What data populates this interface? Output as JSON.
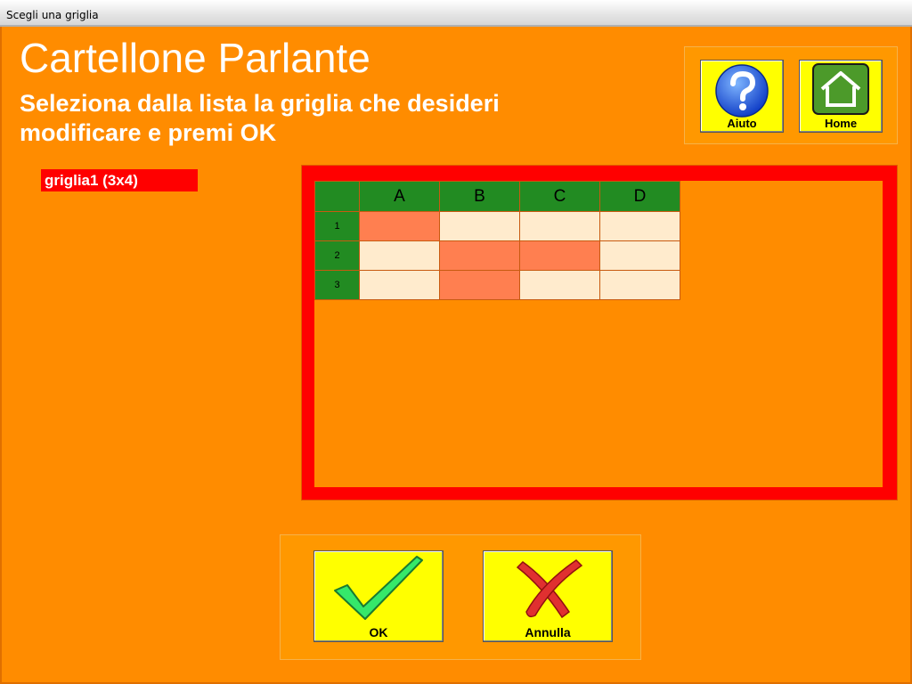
{
  "window": {
    "title": "Scegli una griglia"
  },
  "header": {
    "title": "Cartellone Parlante",
    "subtitle": "Seleziona dalla lista la griglia che desideri modificare e premi OK"
  },
  "toolbar": {
    "help_label": "Aiuto",
    "home_label": "Home",
    "help_icon": "question-icon",
    "home_icon": "house-icon"
  },
  "grid_list": {
    "items": [
      {
        "label": "griglia1 (3x4)",
        "selected": true
      }
    ]
  },
  "preview": {
    "columns": [
      "A",
      "B",
      "C",
      "D"
    ],
    "rows": [
      "1",
      "2",
      "3"
    ],
    "cells": [
      [
        "marked",
        "empty",
        "empty",
        "empty"
      ],
      [
        "empty",
        "marked",
        "marked",
        "empty"
      ],
      [
        "empty",
        "marked",
        "empty",
        "empty"
      ]
    ],
    "colors": {
      "marked": "#ff7f50",
      "empty": "#ffebcd",
      "header": "#228b22",
      "frame": "#ff0000"
    }
  },
  "actions": {
    "ok_label": "OK",
    "cancel_label": "Annulla",
    "ok_icon": "checkmark-icon",
    "cancel_icon": "cross-icon"
  }
}
